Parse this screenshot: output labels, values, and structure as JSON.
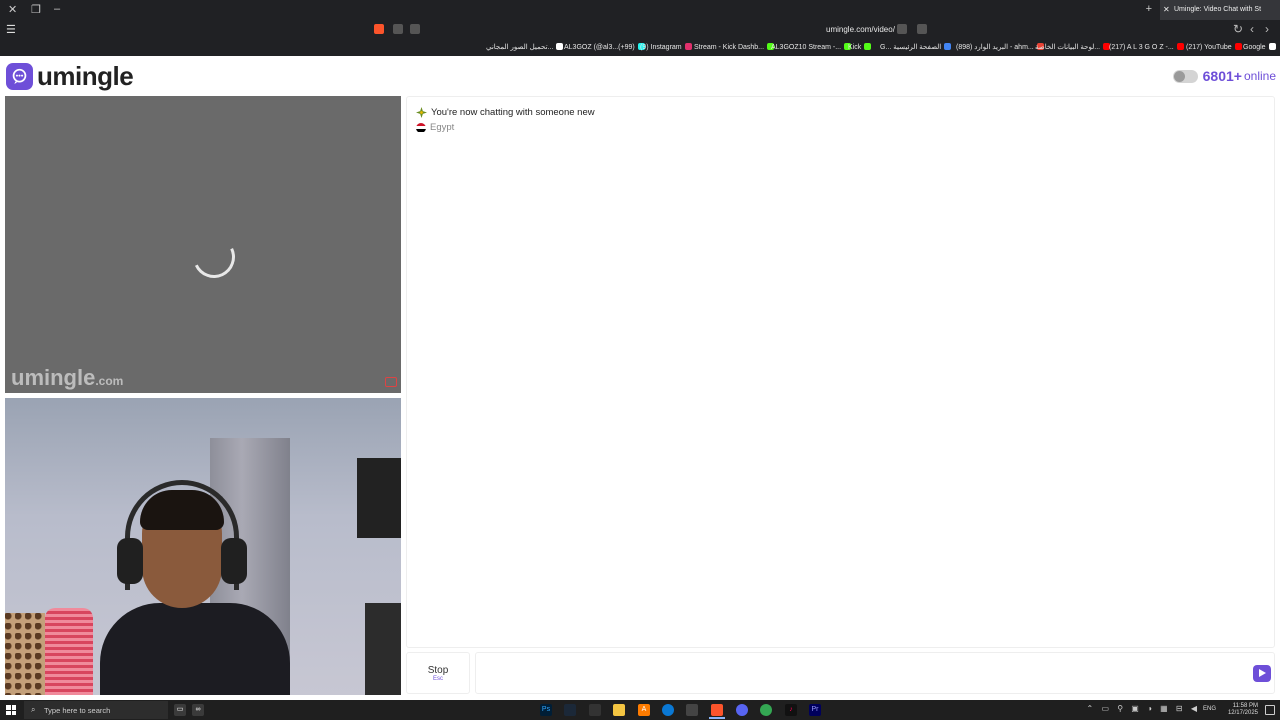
{
  "browser": {
    "active_tab_title": "Umingle: Video Chat with St",
    "url": "umingle.com/video/",
    "bookmarks": [
      {
        "label": "تحميل الصور المجاني...",
        "color": "#ffffff"
      },
      {
        "label": "AL3GOZ (@al3...(+99)",
        "color": "#25f4ee"
      },
      {
        "label": "(9) Instagram",
        "color": "#e1306c"
      },
      {
        "label": "Stream - Kick Dashb...",
        "color": "#53fc18"
      },
      {
        "label": "AL3GOZ10 Stream -...",
        "color": "#53fc18"
      },
      {
        "label": "Kick",
        "color": "#53fc18"
      },
      {
        "label": "G... الصفحة الرئيسية",
        "color": "#4285f4"
      },
      {
        "label": "(898) البريد الوارد - ahm...",
        "color": "#ea4335"
      },
      {
        "label": "لوحة البيانات الخاصة...",
        "color": "#ff0000"
      },
      {
        "label": "(217) A L 3 G O Z -...",
        "color": "#ff0000"
      },
      {
        "label": "(217) YouTube",
        "color": "#ff0000"
      },
      {
        "label": "Google",
        "color": "#ffffff"
      }
    ]
  },
  "header": {
    "logo_text": "umingle",
    "online_count": "6801+",
    "online_label": "online"
  },
  "video": {
    "watermark_main": "umingle",
    "watermark_domain": ".com"
  },
  "chat": {
    "status_message": "You're now chatting with someone new",
    "country": "Egypt",
    "input_placeholder": ""
  },
  "controls": {
    "stop_label": "Stop",
    "stop_hint": "Esc"
  },
  "taskbar": {
    "search_placeholder": "Type here to search",
    "language": "ENG",
    "time": "11:58 PM",
    "date": "12/17/2025"
  },
  "colors": {
    "brand": "#6e4fd8",
    "video_bg": "#6a6a6a",
    "chrome_bg": "#202124"
  }
}
